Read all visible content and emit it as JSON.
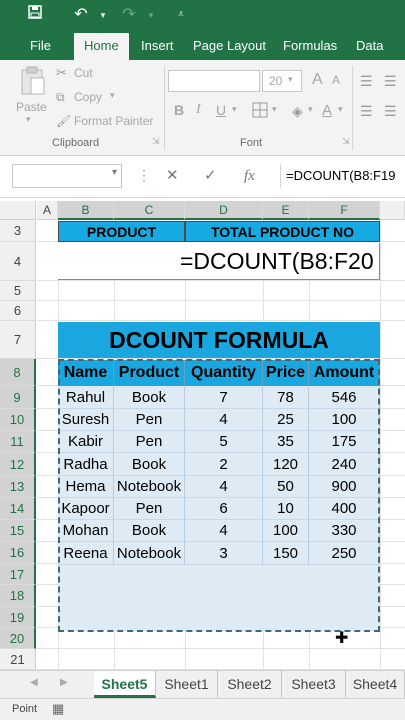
{
  "quick_access": {
    "save_icon": "save-icon",
    "undo_icon": "undo-icon",
    "redo_icon": "redo-icon",
    "customize_icon": "customize-qat-icon"
  },
  "ribbon_tabs": [
    {
      "label": "File"
    },
    {
      "label": "Home"
    },
    {
      "label": "Insert"
    },
    {
      "label": "Page Layout"
    },
    {
      "label": "Formulas"
    },
    {
      "label": "Data"
    }
  ],
  "clipboard": {
    "paste_label": "Paste",
    "cut_label": "Cut",
    "copy_label": "Copy",
    "format_painter_label": "Format Painter",
    "group_label": "Clipboard"
  },
  "font": {
    "size_value": "20",
    "group_label": "Font",
    "bold": "B",
    "italic": "I",
    "underline": "U",
    "grow": "A",
    "shrink": "A"
  },
  "formula_bar": {
    "name_box": "",
    "cancel_symbol": "✕",
    "enter_symbol": "✓",
    "fx_label": "fx",
    "formula": "=DCOUNT(B8:F19"
  },
  "columns": [
    "A",
    "B",
    "C",
    "D",
    "E",
    "F"
  ],
  "rows": [
    "3",
    "4",
    "5",
    "6",
    "7",
    "8",
    "9",
    "10",
    "11",
    "12",
    "13",
    "14",
    "15",
    "16",
    "17",
    "18",
    "19",
    "20",
    "21"
  ],
  "header_block": {
    "product_label": "PRODUCT",
    "total_label": "TOTAL PRODUCT NO",
    "cell_formula": "=DCOUNT(B8:F20"
  },
  "table": {
    "title": "DCOUNT FORMULA",
    "headers": [
      "Name",
      "Product",
      "Quantity",
      "Price",
      "Amount"
    ],
    "rows": [
      [
        "Rahul",
        "Book",
        "7",
        "78",
        "546"
      ],
      [
        "Suresh",
        "Pen",
        "4",
        "25",
        "100"
      ],
      [
        "Kabir",
        "Pen",
        "5",
        "35",
        "175"
      ],
      [
        "Radha",
        "Book",
        "2",
        "120",
        "240"
      ],
      [
        "Hema",
        "Notebook",
        "4",
        "50",
        "900"
      ],
      [
        "Kapoor",
        "Pen",
        "6",
        "10",
        "400"
      ],
      [
        "Mohan",
        "Book",
        "4",
        "100",
        "330"
      ],
      [
        "Reena",
        "Notebook",
        "3",
        "150",
        "250"
      ]
    ]
  },
  "sheet_tabs": [
    {
      "label": "Sheet5",
      "active": true
    },
    {
      "label": "Sheet1"
    },
    {
      "label": "Sheet2"
    },
    {
      "label": "Sheet3"
    },
    {
      "label": "Sheet4"
    }
  ],
  "status": {
    "mode": "Point"
  },
  "colors": {
    "excel_green": "#217346",
    "header_blue": "#17a9e1",
    "table_fill": "#deebf5"
  }
}
